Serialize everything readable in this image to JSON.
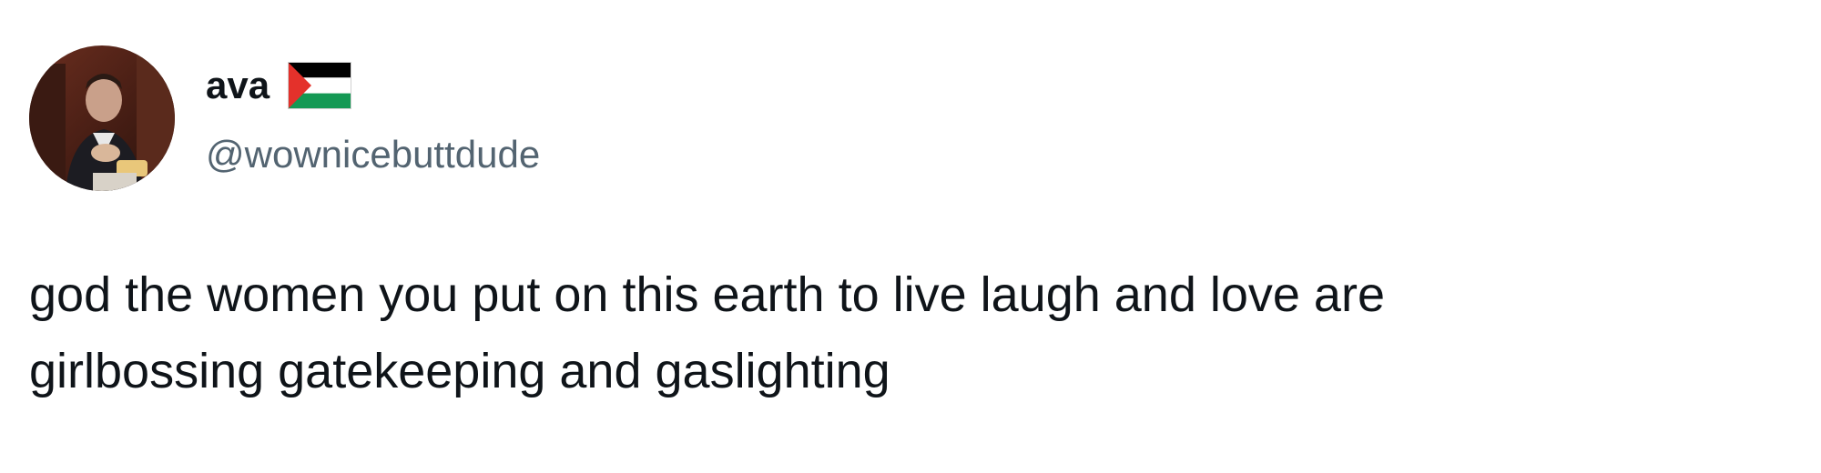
{
  "author": {
    "display_name": "ava",
    "handle": "@wownicebuttdude",
    "name_badge_icon": "palestine-flag-icon",
    "avatar_icon": "user-avatar"
  },
  "tweet": {
    "text_lines": [
      "god the women you put on this earth to live laugh and love are",
      "girlbossing gatekeeping and gaslighting"
    ]
  },
  "colors": {
    "text_primary": "#0f1419",
    "text_secondary": "#536471",
    "background": "#ffffff",
    "flag_black": "#000000",
    "flag_white": "#ffffff",
    "flag_green": "#149954",
    "flag_red": "#e4312b"
  }
}
